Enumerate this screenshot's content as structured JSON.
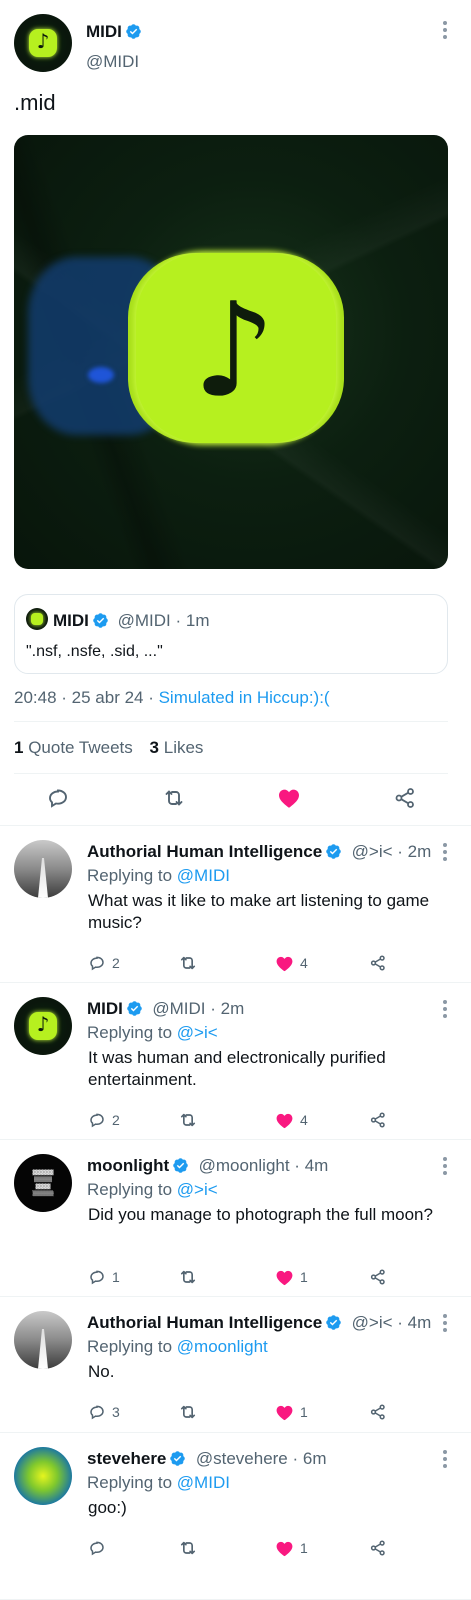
{
  "main_tweet": {
    "name": "MIDI",
    "handle": "@MIDI",
    "text": ".mid",
    "media_icon": "music-note-icon",
    "quoted": {
      "name": "MIDI",
      "handle": "@MIDI",
      "time": "1m",
      "text": "\".nsf, .nsfe, .sid, ...\""
    },
    "timestamp": "20:48 · 25 abr 24 · ",
    "source": "Simulated in Hiccup:):(",
    "quote_tweets_count": "1",
    "quote_tweets_label": "Quote Tweets",
    "likes_count": "3",
    "likes_label": "Likes"
  },
  "colors": {
    "like_red": "#f91880",
    "link_blue": "#1d9bf0",
    "verified_blue": "#1d9bf0",
    "midi_green": "#b6f01f"
  },
  "replies": [
    {
      "name": "Authorial Human Intelligence",
      "handle": "@>i<",
      "time": "2m",
      "replying_label": "Replying to",
      "replying_to": "@MIDI",
      "text": "What was it like to make art listening to game music?",
      "reply_count": "2",
      "retweet_count": "",
      "like_count": "4"
    },
    {
      "name": "MIDI",
      "handle": "@MIDI",
      "time": "2m",
      "replying_label": "Replying to",
      "replying_to": "@>i<",
      "text": "It was human and electronically purified entertainment.",
      "reply_count": "2",
      "retweet_count": "",
      "like_count": "4"
    },
    {
      "name": "moonlight",
      "handle": "@moonlight",
      "time": "4m",
      "replying_label": "Replying to",
      "replying_to": "@>i<",
      "text": "Did you manage to photograph the full moon?",
      "reply_count": "1",
      "retweet_count": "",
      "like_count": "1"
    },
    {
      "name": "Authorial Human Intelligence",
      "handle": "@>i<",
      "time": "4m",
      "replying_label": "Replying to",
      "replying_to": "@moonlight",
      "text": "No.",
      "reply_count": "3",
      "retweet_count": "",
      "like_count": "1"
    },
    {
      "name": "stevehere",
      "handle": "@stevehere",
      "time": "6m",
      "replying_label": "Replying to",
      "replying_to": "@MIDI",
      "text": "goo:)",
      "reply_count": "",
      "retweet_count": "",
      "like_count": "1"
    }
  ]
}
